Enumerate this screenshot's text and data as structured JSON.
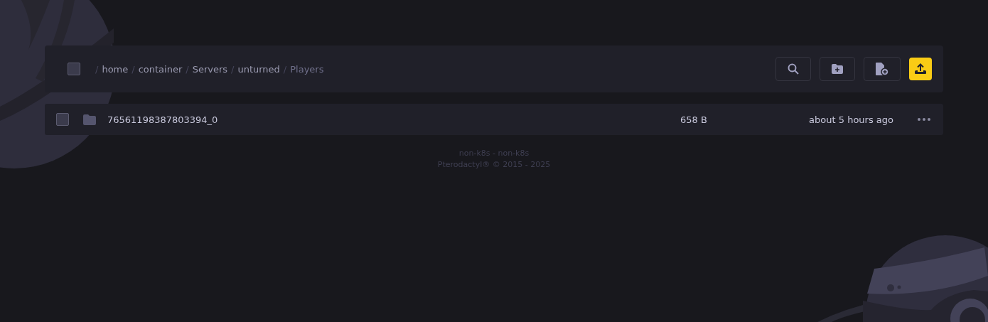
{
  "breadcrumb": {
    "select_all": {
      "checked": false
    },
    "segments": [
      {
        "separator": "/",
        "label": "home"
      },
      {
        "separator": "/",
        "label": "container"
      },
      {
        "separator": "/",
        "label": "Servers"
      },
      {
        "separator": "/",
        "label": "unturned"
      },
      {
        "separator": "/",
        "label": "Players"
      }
    ]
  },
  "files": [
    {
      "name": "76561198387803394_0",
      "kind": "folder",
      "size": "658 B",
      "modified": "about 5 hours ago",
      "checked": false
    }
  ],
  "footer": [
    "non-k8s - non-k8s",
    "Pterodactyl® © 2015 - 2025"
  ]
}
